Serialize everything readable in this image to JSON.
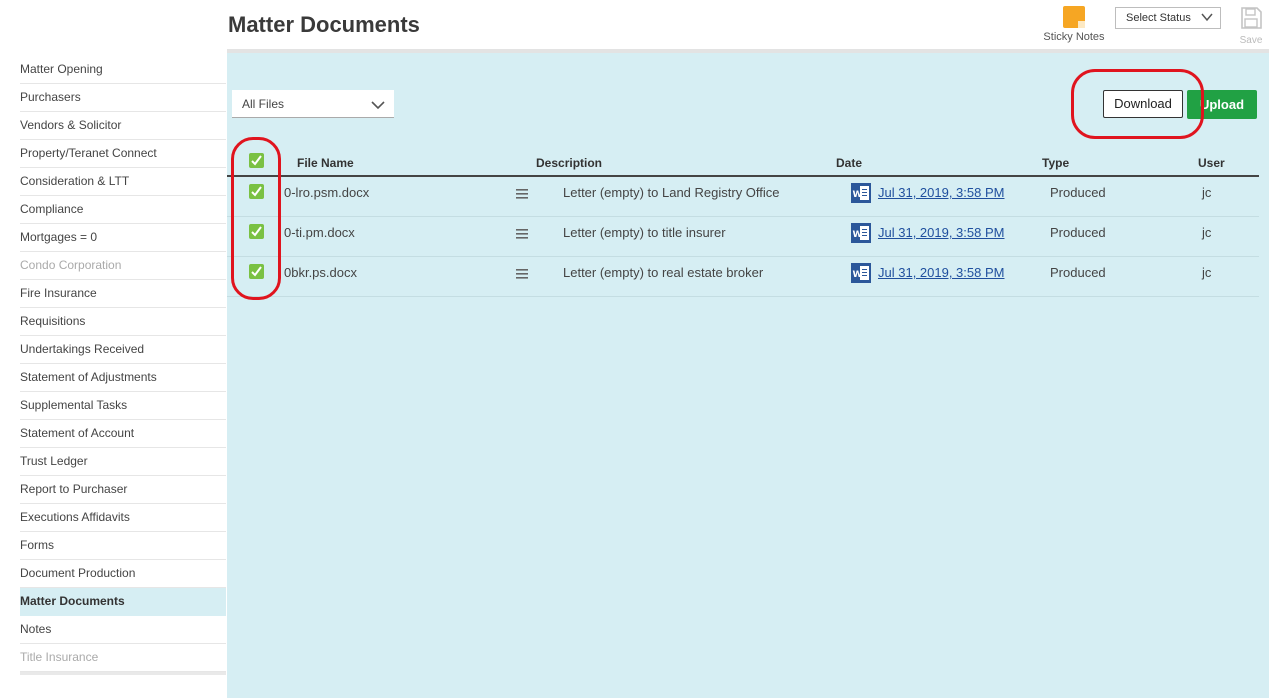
{
  "header": {
    "title": "Matter Documents",
    "sticky_notes_label": "Sticky Notes",
    "status_select_value": "Select Status",
    "save_label": "Save"
  },
  "sidebar": {
    "items": [
      {
        "label": "Matter Opening",
        "state": "normal"
      },
      {
        "label": "Purchasers",
        "state": "normal"
      },
      {
        "label": "Vendors & Solicitor",
        "state": "normal"
      },
      {
        "label": "Property/Teranet Connect",
        "state": "normal"
      },
      {
        "label": "Consideration & LTT",
        "state": "normal"
      },
      {
        "label": "Compliance",
        "state": "normal"
      },
      {
        "label": "Mortgages = 0",
        "state": "normal"
      },
      {
        "label": "Condo Corporation",
        "state": "disabled"
      },
      {
        "label": "Fire Insurance",
        "state": "normal"
      },
      {
        "label": "Requisitions",
        "state": "normal"
      },
      {
        "label": "Undertakings Received",
        "state": "normal"
      },
      {
        "label": "Statement of Adjustments",
        "state": "normal"
      },
      {
        "label": "Supplemental Tasks",
        "state": "normal"
      },
      {
        "label": "Statement of Account",
        "state": "normal"
      },
      {
        "label": "Trust Ledger",
        "state": "normal"
      },
      {
        "label": "Report to Purchaser",
        "state": "normal"
      },
      {
        "label": "Executions Affidavits",
        "state": "normal"
      },
      {
        "label": "Forms",
        "state": "normal"
      },
      {
        "label": "Document Production",
        "state": "normal"
      },
      {
        "label": "Matter Documents",
        "state": "active"
      },
      {
        "label": "Notes",
        "state": "normal"
      },
      {
        "label": "Title Insurance",
        "state": "disabled"
      }
    ]
  },
  "toolbar": {
    "filter_value": "All Files",
    "download_label": "Download",
    "upload_label": "Upload"
  },
  "table": {
    "headers": {
      "file_name": "File Name",
      "description": "Description",
      "date": "Date",
      "type": "Type",
      "user": "User"
    },
    "all_checked": true,
    "rows": [
      {
        "checked": true,
        "file_name": "0-lro.psm.docx",
        "description": "Letter (empty) to Land Registry Office",
        "date": "Jul 31, 2019, 3:58 PM",
        "type": "Produced",
        "user": "jc"
      },
      {
        "checked": true,
        "file_name": "0-ti.pm.docx",
        "description": "Letter (empty) to title insurer",
        "date": "Jul 31, 2019, 3:58 PM",
        "type": "Produced",
        "user": "jc"
      },
      {
        "checked": true,
        "file_name": "0bkr.ps.docx",
        "description": "Letter (empty) to real estate broker",
        "date": "Jul 31, 2019, 3:58 PM",
        "type": "Produced",
        "user": "jc"
      }
    ]
  },
  "icons": {
    "sticky": "sticky-note-icon",
    "save": "floppy-disk-icon",
    "chevron": "chevron-down-icon",
    "menu": "hamburger-menu-icon",
    "word": "word-document-icon",
    "check": "checkmark-icon"
  },
  "colors": {
    "accent_green": "#21a144",
    "checkbox_green": "#7ac143",
    "panel_bg": "#d6eef3",
    "annotation_red": "#e0141e",
    "sticky_orange": "#f6a623",
    "link_blue": "#1f4f9e"
  }
}
